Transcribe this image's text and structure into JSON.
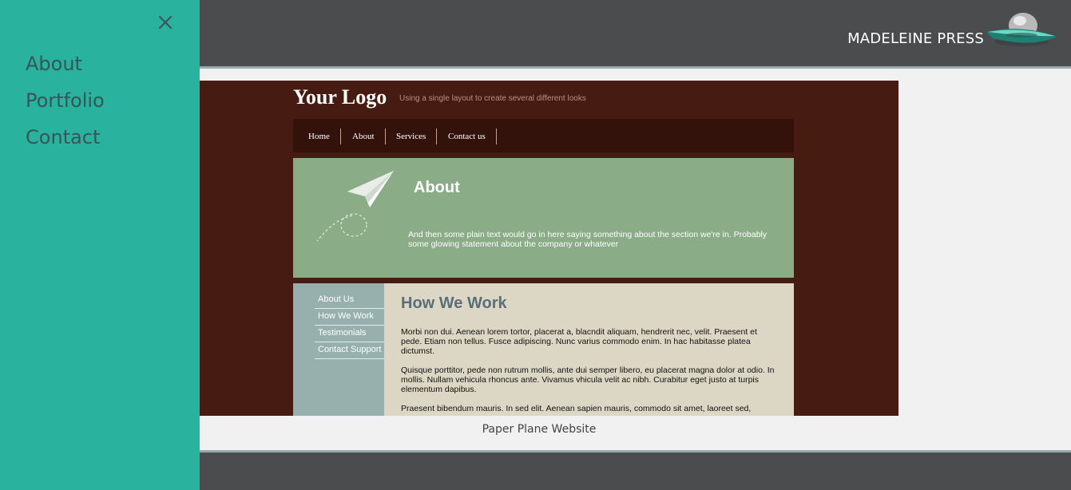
{
  "sidebar": {
    "close_icon": "close-icon",
    "items": [
      {
        "label": "About"
      },
      {
        "label": "Portfolio"
      },
      {
        "label": "Contact"
      }
    ]
  },
  "header": {
    "brand": "MADELEINE PRESS",
    "logo_icon": "ufo-icon"
  },
  "preview": {
    "logo": "Your Logo",
    "tagline": "Using a single layout to create several different looks",
    "nav": [
      "Home",
      "About",
      "Services",
      "Contact us"
    ],
    "hero_title": "About",
    "hero_text": "And then some plain text would go in here saying something about the section we're in. Probably some glowing statement about the company or whatever",
    "side_links": [
      "About Us",
      "How We Work",
      "Testimonials",
      "Contact Support"
    ],
    "body_title": "How We Work",
    "paragraphs": [
      "Morbi non dui. Aenean lorem tortor, placerat a, blacndit aliquam, hendrerit nec, velit. Praesent et pede. Etiam non tellus. Fusce adipiscing. Nunc varius commodo enim. In hac habitasse platea dictumst.",
      "Quisque porttitor, pede non rutrum mollis, ante dui semper libero, eu placerat magna dolor at odio. In mollis. Nullam vehicula rhoncus ante. Vivamus vhicula velit ac nibh. Curabitur eget justo at turpis elementum dapibus.",
      "Praesent bibendum mauris. In sed elit. Aenean sapien mauris, commodo sit amet, laoreet sed,"
    ]
  },
  "caption": "Paper Plane Website",
  "colors": {
    "sidebar": "#29b29d",
    "header": "#4b4c4e",
    "accent_border": "#98a8b0",
    "sidebar_text": "#37555a"
  }
}
